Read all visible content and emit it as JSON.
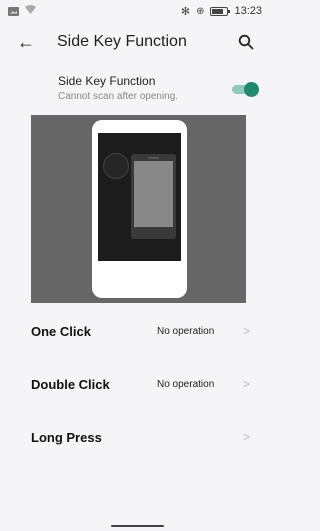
{
  "status_bar": {
    "time": "13:23",
    "icons": [
      "image-icon",
      "wifi-icon",
      "bluetooth-icon",
      "vibrate-icon",
      "battery-icon"
    ],
    "bluetooth_glyph": "✻",
    "vibrate_glyph": "⊕"
  },
  "app_bar": {
    "title": "Side Key Function",
    "back_glyph": "←"
  },
  "toggle": {
    "title": "Side Key Function",
    "subtitle": "Cannot scan after opening.",
    "enabled": true
  },
  "colors": {
    "accent": "#1f8a70",
    "accent_track": "#8fc8bd",
    "background": "#f5f5f7",
    "illustration_bg": "#666666"
  },
  "menu": {
    "items": [
      {
        "label": "One Click",
        "value": "No operation"
      },
      {
        "label": "Double Click",
        "value": "No operation"
      },
      {
        "label": "Long Press",
        "value": ""
      }
    ],
    "chevron_glyph": ">"
  }
}
